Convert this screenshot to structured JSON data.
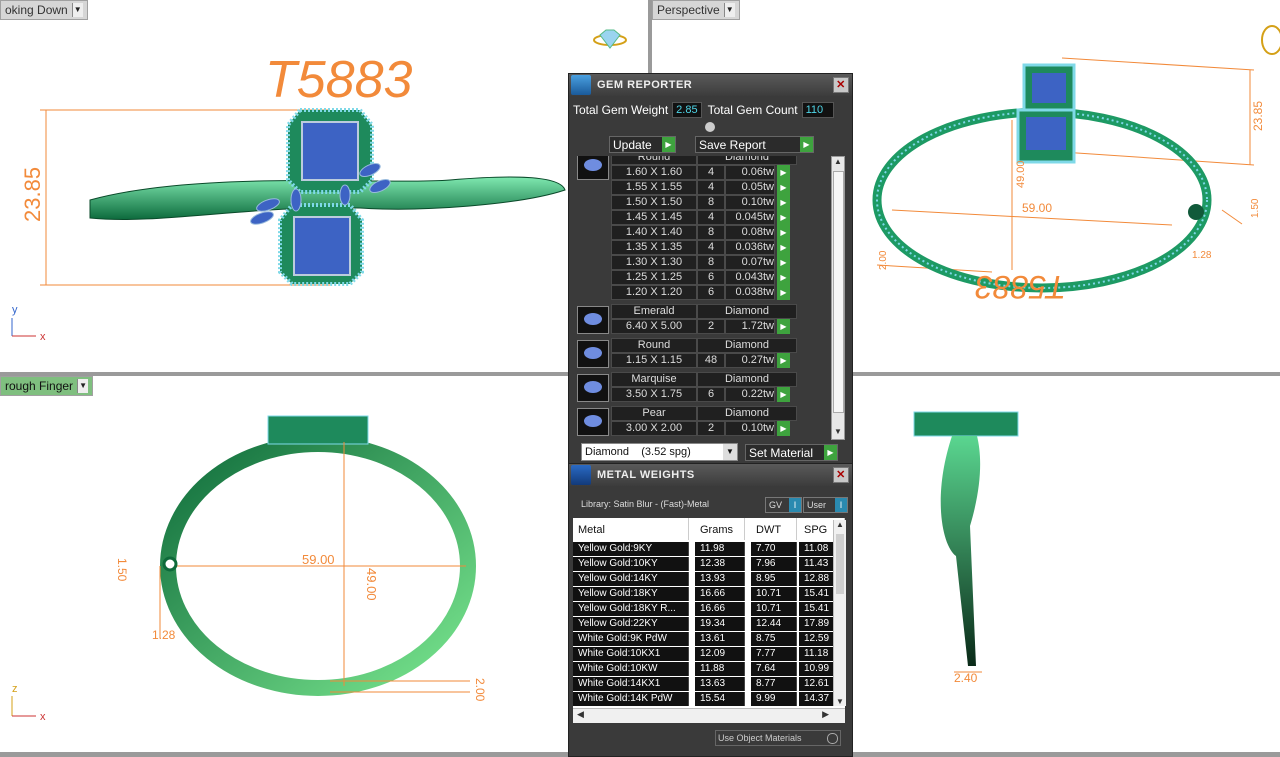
{
  "viewports": {
    "top_left": {
      "label": "oking Down",
      "title_text": "T5883",
      "dim_height": "23.85",
      "axis_x": "x",
      "axis_y": "y"
    },
    "top_right": {
      "label": "Perspective",
      "dim_a": "23.85",
      "dim_b": "49.00",
      "dim_c": "59.00",
      "dim_d": "1.50",
      "dim_e": "2.00",
      "dim_f": "1.28",
      "mirror_text": "T5883"
    },
    "bottom_left": {
      "label": "rough Finger",
      "dim_width": "59.00",
      "dim_height": "49.00",
      "dim_left": "1.50",
      "dim_small": "1.28",
      "dim_bottom": "2.00",
      "axis_x": "x",
      "axis_z": "z"
    },
    "bottom_right": {
      "dim": "2.40"
    }
  },
  "gem_reporter": {
    "title": "GEM REPORTER",
    "total_weight_label": "Total Gem Weight",
    "total_weight": "2.85",
    "total_count_label": "Total Gem Count",
    "total_count": "110",
    "update_label": "Update",
    "save_label": "Save Report",
    "groups": [
      {
        "shape": "Round",
        "material": "Diamond",
        "rows": [
          {
            "size": "1.60 X 1.60",
            "count": "4",
            "weight": "0.06tw"
          },
          {
            "size": "1.55 X 1.55",
            "count": "4",
            "weight": "0.05tw"
          },
          {
            "size": "1.50 X 1.50",
            "count": "8",
            "weight": "0.10tw"
          },
          {
            "size": "1.45 X 1.45",
            "count": "4",
            "weight": "0.045tw"
          },
          {
            "size": "1.40 X 1.40",
            "count": "8",
            "weight": "0.08tw"
          },
          {
            "size": "1.35 X 1.35",
            "count": "4",
            "weight": "0.036tw"
          },
          {
            "size": "1.30 X 1.30",
            "count": "8",
            "weight": "0.07tw"
          },
          {
            "size": "1.25 X 1.25",
            "count": "6",
            "weight": "0.043tw"
          },
          {
            "size": "1.20 X 1.20",
            "count": "6",
            "weight": "0.038tw"
          }
        ]
      },
      {
        "shape": "Emerald",
        "material": "Diamond",
        "rows": [
          {
            "size": "6.40 X 5.00",
            "count": "2",
            "weight": "1.72tw"
          }
        ]
      },
      {
        "shape": "Round",
        "material": "Diamond",
        "rows": [
          {
            "size": "1.15 X 1.15",
            "count": "48",
            "weight": "0.27tw"
          }
        ]
      },
      {
        "shape": "Marquise",
        "material": "Diamond",
        "rows": [
          {
            "size": "3.50 X 1.75",
            "count": "6",
            "weight": "0.22tw"
          }
        ]
      },
      {
        "shape": "Pear",
        "material": "Diamond",
        "rows": [
          {
            "size": "3.00 X 2.00",
            "count": "2",
            "weight": "0.10tw"
          }
        ]
      }
    ],
    "material_select": "Diamond    (3.52 spg)",
    "set_material_label": "Set Material"
  },
  "metal_weights": {
    "title": "METAL WEIGHTS",
    "library": "Library: Satin Blur - (Fast)-Metal",
    "gv_label": "GV",
    "user_label": "User",
    "columns": [
      "Metal",
      "Grams",
      "DWT",
      "SPG"
    ],
    "rows": [
      [
        "Yellow Gold:9KY",
        "11.98",
        "7.70",
        "11.08"
      ],
      [
        "Yellow Gold:10KY",
        "12.38",
        "7.96",
        "11.43"
      ],
      [
        "Yellow Gold:14KY",
        "13.93",
        "8.95",
        "12.88"
      ],
      [
        "Yellow Gold:18KY",
        "16.66",
        "10.71",
        "15.41"
      ],
      [
        "Yellow Gold:18KY R...",
        "16.66",
        "10.71",
        "15.41"
      ],
      [
        "Yellow Gold:22KY",
        "19.34",
        "12.44",
        "17.89"
      ],
      [
        "White Gold:9K PdW",
        "13.61",
        "8.75",
        "12.59"
      ],
      [
        "White Gold:10KX1",
        "12.09",
        "7.77",
        "11.18"
      ],
      [
        "White Gold:10KW",
        "11.88",
        "7.64",
        "10.99"
      ],
      [
        "White Gold:14KX1",
        "13.63",
        "8.77",
        "12.61"
      ],
      [
        "White Gold:14K PdW",
        "15.54",
        "9.99",
        "14.37"
      ]
    ],
    "use_object_label": "Use Object Materials"
  }
}
